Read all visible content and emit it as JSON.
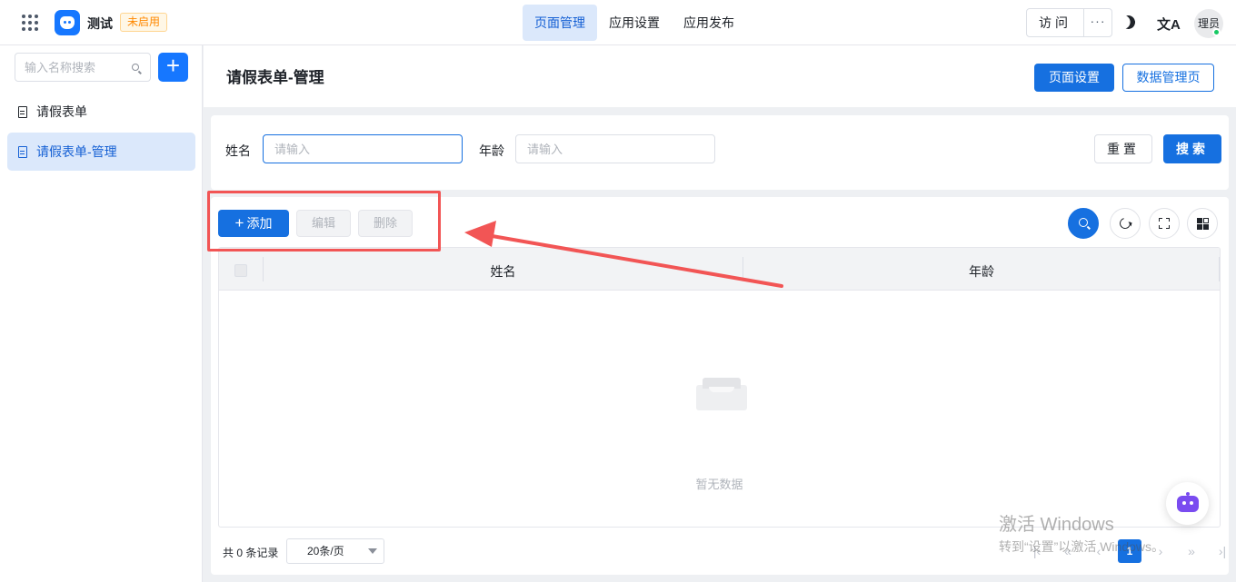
{
  "app": {
    "name": "测试",
    "status": "未启用"
  },
  "top_nav": {
    "items": [
      {
        "label": "页面管理",
        "active": true
      },
      {
        "label": "应用设置",
        "active": false
      },
      {
        "label": "应用发布",
        "active": false
      }
    ]
  },
  "header_actions": {
    "visit": "访问",
    "more": "···",
    "lang_icon": "文A",
    "avatar_text": "理员"
  },
  "sidebar": {
    "search_placeholder": "输入名称搜索",
    "add_label": "+",
    "items": [
      {
        "label": "请假表单",
        "active": false
      },
      {
        "label": "请假表单-管理",
        "active": true
      }
    ]
  },
  "page": {
    "title": "请假表单-管理",
    "settings_button": "页面设置",
    "data_button": "数据管理页"
  },
  "filters": {
    "name_label": "姓名",
    "name_placeholder": "请输入",
    "name_value": "",
    "age_label": "年龄",
    "age_placeholder": "请输入",
    "age_value": "",
    "reset": "重置",
    "search": "搜索"
  },
  "toolbar": {
    "add_icon": "+",
    "add": "添加",
    "edit": "编辑",
    "delete": "删除"
  },
  "table": {
    "columns": [
      "姓名",
      "年龄"
    ],
    "rows": [],
    "empty_text": "暂无数据"
  },
  "pagination": {
    "total_text": "共 0 条记录",
    "page_size": "20条/页",
    "current_page": "1"
  },
  "watermark": {
    "title": "激活 Windows",
    "subtitle": "转到“设置”以激活 Windows。"
  },
  "colors": {
    "primary": "#1670e0",
    "annotation": "#f25555",
    "status_badge": "#ff8800"
  }
}
